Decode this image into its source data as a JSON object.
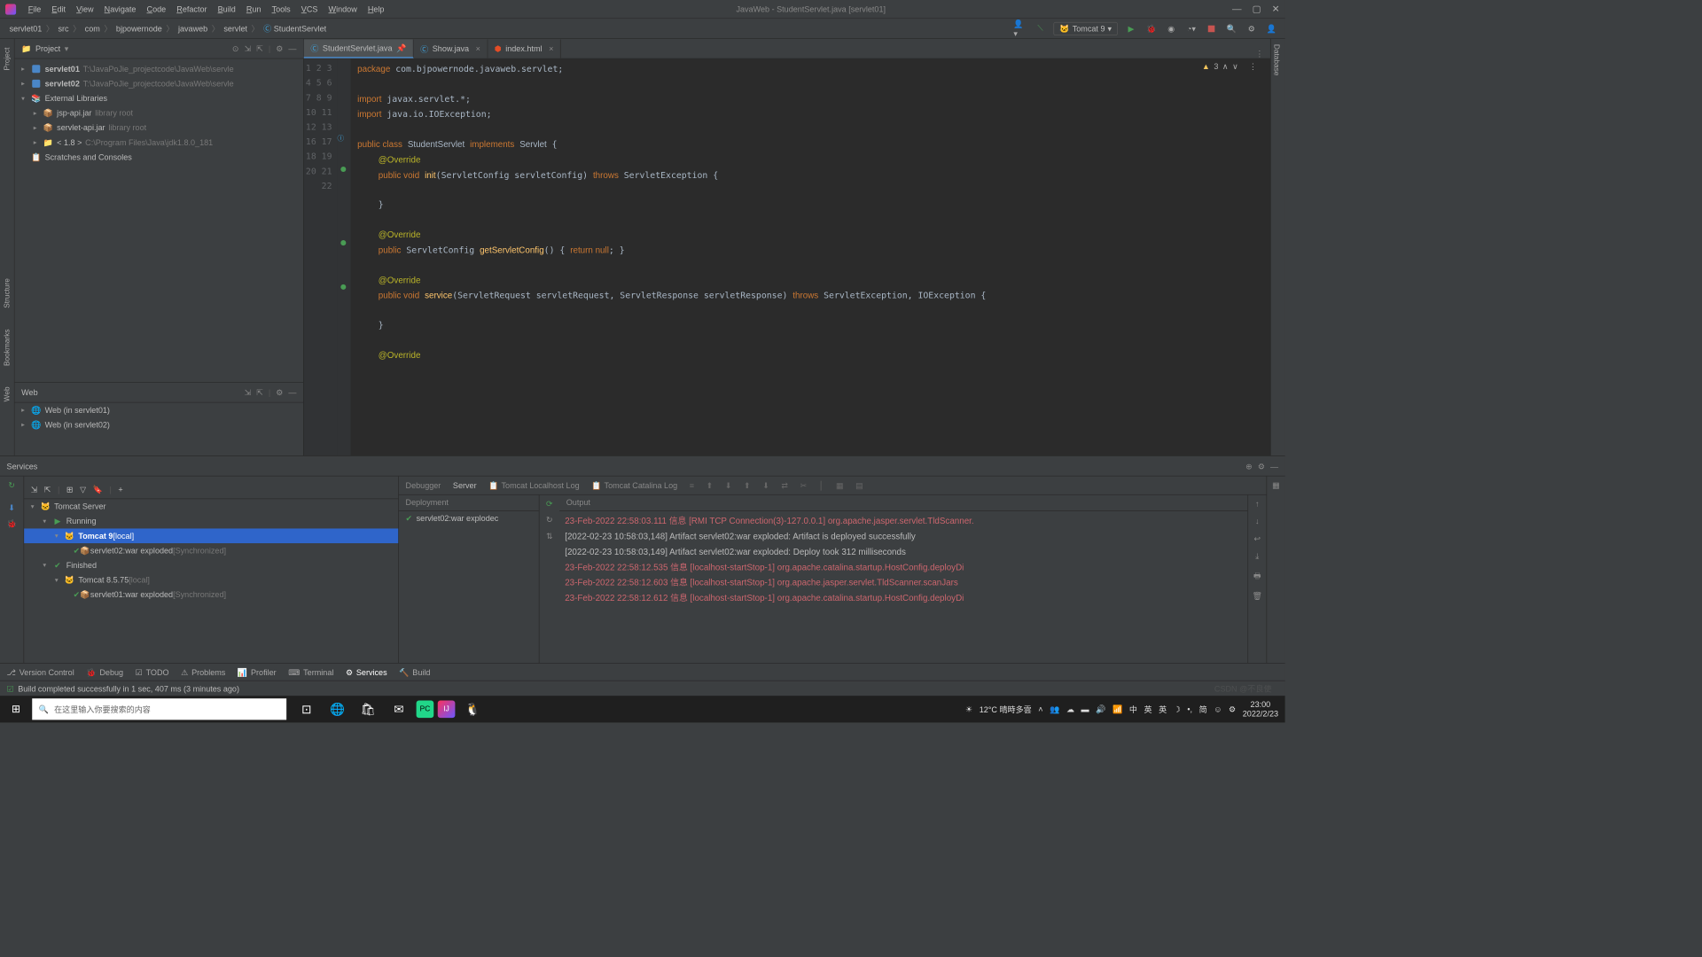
{
  "title": "JavaWeb - StudentServlet.java [servlet01]",
  "menu": [
    "File",
    "Edit",
    "View",
    "Navigate",
    "Code",
    "Refactor",
    "Build",
    "Run",
    "Tools",
    "VCS",
    "Window",
    "Help"
  ],
  "breadcrumbs": [
    "servlet01",
    "src",
    "com",
    "bjpowernode",
    "javaweb",
    "servlet",
    "StudentServlet"
  ],
  "run_config": "Tomcat 9",
  "project": {
    "title": "Project",
    "items": [
      {
        "depth": 0,
        "arrow": ">",
        "icon": "module",
        "label": "servlet01",
        "path": "T:\\JavaPoJie_projectcode\\JavaWeb\\servle"
      },
      {
        "depth": 0,
        "arrow": ">",
        "icon": "module",
        "label": "servlet02",
        "path": "T:\\JavaPoJie_projectcode\\JavaWeb\\servle"
      },
      {
        "depth": 0,
        "arrow": "v",
        "icon": "lib",
        "label": "External Libraries",
        "path": ""
      },
      {
        "depth": 1,
        "arrow": ">",
        "icon": "jar",
        "label": "jsp-api.jar",
        "path": "library root"
      },
      {
        "depth": 1,
        "arrow": ">",
        "icon": "jar",
        "label": "servlet-api.jar",
        "path": "library root"
      },
      {
        "depth": 1,
        "arrow": ">",
        "icon": "folder",
        "label": "< 1.8 >",
        "path": "C:\\Program Files\\Java\\jdk1.8.0_181"
      },
      {
        "depth": 0,
        "arrow": "",
        "icon": "scratch",
        "label": "Scratches and Consoles",
        "path": ""
      }
    ]
  },
  "web_panel": {
    "title": "Web",
    "items": [
      "Web (in servlet01)",
      "Web (in servlet02)"
    ]
  },
  "tabs": [
    {
      "label": "StudentServlet.java",
      "icon": "java",
      "active": true,
      "pinned": true
    },
    {
      "label": "Show.java",
      "icon": "java",
      "active": false
    },
    {
      "label": "index.html",
      "icon": "html",
      "active": false
    }
  ],
  "warnings": "3",
  "code_lines": [
    {
      "n": 1,
      "html": "<span class='kw'>package</span> com.bjpowernode.javaweb.servlet;"
    },
    {
      "n": 2,
      "html": ""
    },
    {
      "n": 3,
      "html": "<span class='kw'>import</span> javax.servlet.*;"
    },
    {
      "n": 4,
      "html": "<span class='kw'>import</span> java.io.IOException;"
    },
    {
      "n": 5,
      "html": ""
    },
    {
      "n": 6,
      "html": "<span class='kw'>public class</span> <span class='cls'>StudentServlet</span> <span class='kw'>implements</span> <span class='cls'>Servlet</span> {"
    },
    {
      "n": 7,
      "html": "    <span class='ann'>@Override</span>"
    },
    {
      "n": 8,
      "html": "    <span class='kw'>public void</span> <span class='mth'>init</span>(ServletConfig servletConfig) <span class='kw'>throws</span> ServletException {"
    },
    {
      "n": 9,
      "html": ""
    },
    {
      "n": 10,
      "html": "    }"
    },
    {
      "n": 11,
      "html": ""
    },
    {
      "n": 12,
      "html": "    <span class='ann'>@Override</span>"
    },
    {
      "n": 13,
      "html": "    <span class='kw'>public</span> ServletConfig <span class='mth'>getServletConfig</span>() { <span class='kw'>return null</span>; }"
    },
    {
      "n": 16,
      "html": ""
    },
    {
      "n": 17,
      "html": "    <span class='ann'>@Override</span>"
    },
    {
      "n": 18,
      "html": "    <span class='kw'>public void</span> <span class='mth'>service</span>(ServletRequest servletRequest, ServletResponse servletResponse) <span class='kw'>throws</span> ServletException, IOException {"
    },
    {
      "n": 19,
      "html": ""
    },
    {
      "n": 20,
      "html": "    }"
    },
    {
      "n": 21,
      "html": ""
    },
    {
      "n": 22,
      "html": "    <span class='ann'>@Override</span>"
    }
  ],
  "gutter_marks": {
    "6": "class",
    "8": "override",
    "13": "override",
    "18": "override"
  },
  "services": {
    "title": "Services",
    "tree": [
      {
        "depth": 0,
        "arrow": "v",
        "icon": "tomcat",
        "label": "Tomcat Server"
      },
      {
        "depth": 1,
        "arrow": "v",
        "icon": "play",
        "label": "Running"
      },
      {
        "depth": 2,
        "arrow": "v",
        "icon": "tomcat",
        "label": "Tomcat 9",
        "suffix": "[local]",
        "selected": true
      },
      {
        "depth": 3,
        "arrow": "",
        "icon": "artifact",
        "label": "servlet02:war exploded",
        "suffix": "[Synchronized]"
      },
      {
        "depth": 1,
        "arrow": "v",
        "icon": "done",
        "label": "Finished"
      },
      {
        "depth": 2,
        "arrow": "v",
        "icon": "tomcat",
        "label": "Tomcat 8.5.75",
        "suffix": "[local]"
      },
      {
        "depth": 3,
        "arrow": "",
        "icon": "artifact",
        "label": "servlet01:war exploded",
        "suffix": "[Synchronized]"
      }
    ],
    "tabs": [
      "Debugger",
      "Server",
      "Tomcat Localhost Log",
      "Tomcat Catalina Log"
    ],
    "active_tab": 1,
    "deployment_header": "Deployment",
    "output_header": "Output",
    "deploy_item": "servlet02:war explodec",
    "output": [
      {
        "cls": "log-red",
        "text": "23-Feb-2022 22:58:03.111 信息 [RMI TCP Connection(3)-127.0.0.1] org.apache.jasper.servlet.TldScanner."
      },
      {
        "cls": "log-gray",
        "text": "[2022-02-23 10:58:03,148] Artifact servlet02:war exploded: Artifact is deployed successfully"
      },
      {
        "cls": "log-gray",
        "text": "[2022-02-23 10:58:03,149] Artifact servlet02:war exploded: Deploy took 312 milliseconds"
      },
      {
        "cls": "log-red",
        "text": "23-Feb-2022 22:58:12.535 信息 [localhost-startStop-1] org.apache.catalina.startup.HostConfig.deployDi"
      },
      {
        "cls": "log-red",
        "text": "23-Feb-2022 22:58:12.603 信息 [localhost-startStop-1] org.apache.jasper.servlet.TldScanner.scanJars "
      },
      {
        "cls": "log-red",
        "text": "23-Feb-2022 22:58:12.612 信息 [localhost-startStop-1] org.apache.catalina.startup.HostConfig.deployDi"
      }
    ]
  },
  "bottom_tabs": [
    "Version Control",
    "Debug",
    "TODO",
    "Problems",
    "Profiler",
    "Terminal",
    "Services",
    "Build"
  ],
  "active_bottom_tab": 6,
  "status": "Build completed successfully in 1 sec, 407 ms (3 minutes ago)",
  "taskbar": {
    "search_placeholder": "在这里输入你要搜索的内容",
    "weather": "12°C 晴時多雲",
    "ime1": "英",
    "ime2": "简",
    "ime3": "中",
    "ime4": "英",
    "time": "23:00",
    "date": "2022/2/23"
  },
  "watermark": "CSDN @不良使"
}
